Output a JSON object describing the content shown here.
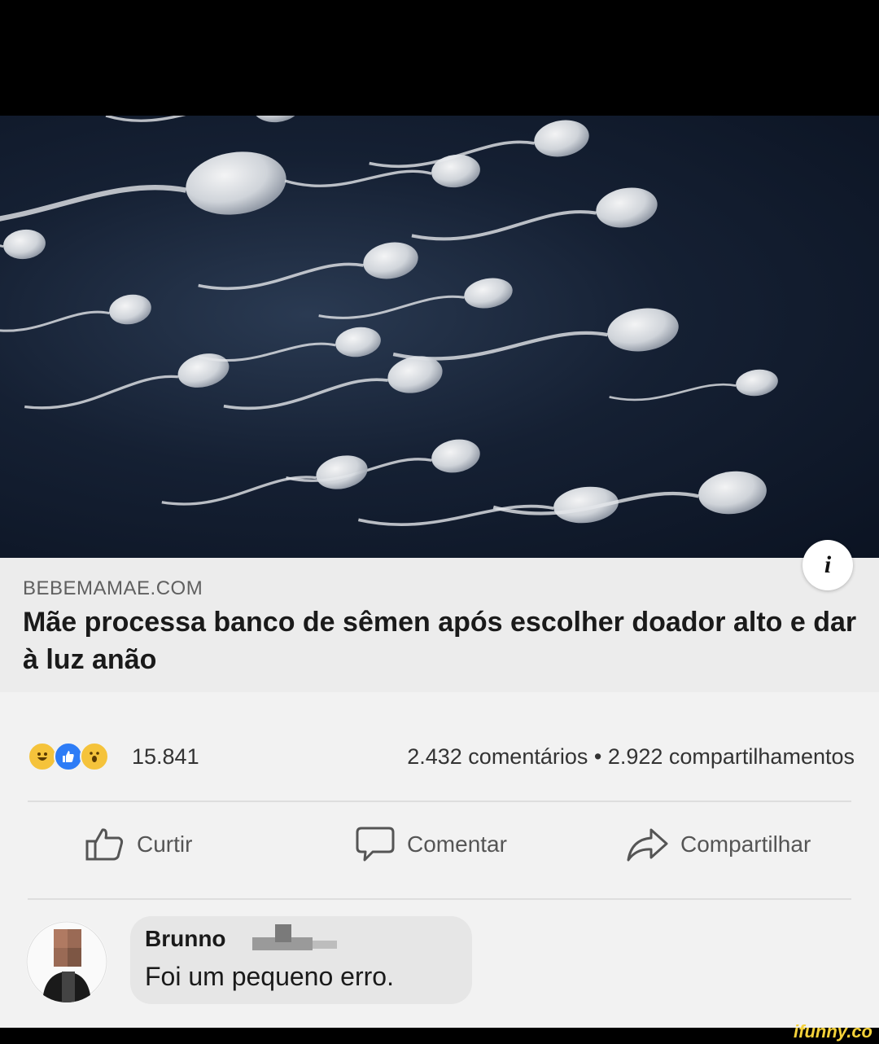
{
  "post": {
    "link": {
      "domain": "BEBEMAMAE.COM",
      "headline": "Mãe processa banco de sêmen após escolher doador alto e dar à luz anão",
      "info_label": "i"
    },
    "stats": {
      "reaction_count": "15.841",
      "comments_shares": "2.432 comentários • 2.922 compartilhamentos",
      "reactions": [
        "haha-icon",
        "like-icon",
        "wow-icon"
      ]
    },
    "actions": {
      "like": "Curtir",
      "comment": "Comentar",
      "share": "Compartilhar"
    },
    "comment": {
      "author": "Brunno",
      "text": "Foi um pequeno erro."
    }
  },
  "watermark": "ifunny.co",
  "colors": {
    "card_bg": "#f2f2f2",
    "hero_bg": "#152033",
    "like_blue": "#2d7cf6",
    "reaction_yellow": "#f5c33b",
    "watermark": "#f5d23a"
  }
}
